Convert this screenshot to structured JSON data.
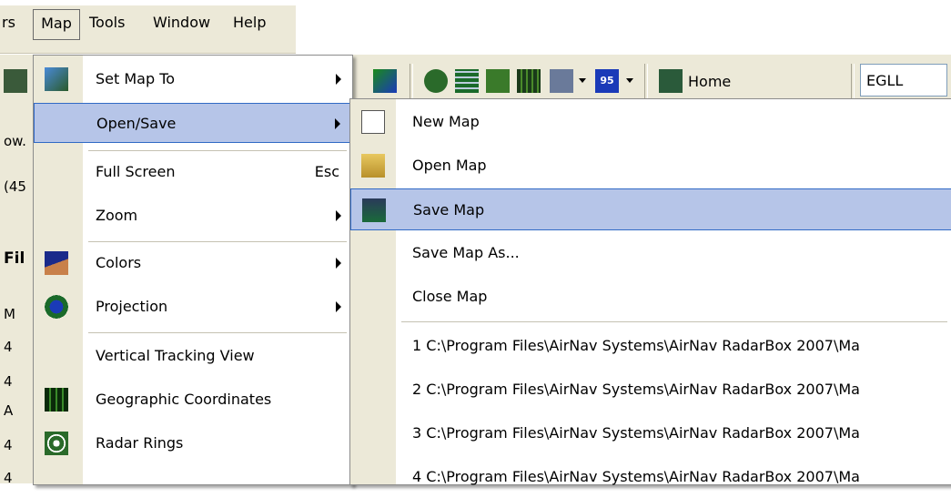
{
  "menubar": {
    "items": [
      {
        "label": "rs"
      },
      {
        "label": "Map"
      },
      {
        "label": "Tools"
      },
      {
        "label": "Window"
      },
      {
        "label": "Help"
      }
    ]
  },
  "toolbar": {
    "home_label": "Home",
    "airport_value": "EGLL",
    "route_badge": "95"
  },
  "left_strip": {
    "texts": [
      "ow.",
      "(45",
      "Fil",
      "M",
      "4",
      "4",
      "A",
      "4",
      "4"
    ]
  },
  "map_menu": {
    "items": [
      {
        "label": "Set Map To",
        "has_submenu": true,
        "icon": "map-edit-icon"
      },
      {
        "label": "Open/Save",
        "has_submenu": true,
        "highlighted": true
      },
      {
        "label": "Full Screen",
        "shortcut": "Esc"
      },
      {
        "label": "Zoom",
        "has_submenu": true
      },
      {
        "label": "Colors",
        "has_submenu": true,
        "icon": "colors-icon"
      },
      {
        "label": "Projection",
        "has_submenu": true,
        "icon": "globe-icon"
      },
      {
        "label": "Vertical Tracking View"
      },
      {
        "label": "Geographic Coordinates",
        "icon": "grid-icon"
      },
      {
        "label": "Radar Rings",
        "icon": "radar-icon"
      }
    ]
  },
  "open_save_menu": {
    "items": [
      {
        "label": "New Map",
        "icon": "new-map-icon"
      },
      {
        "label": "Open Map",
        "icon": "open-folder-icon"
      },
      {
        "label": "Save Map",
        "icon": "save-disk-icon",
        "highlighted": true
      },
      {
        "label": "Save Map As..."
      },
      {
        "label": "Close Map"
      },
      {
        "label": "1 C:\\Program Files\\AirNav Systems\\AirNav RadarBox 2007\\Ma"
      },
      {
        "label": "2 C:\\Program Files\\AirNav Systems\\AirNav RadarBox 2007\\Ma"
      },
      {
        "label": "3 C:\\Program Files\\AirNav Systems\\AirNav RadarBox 2007\\Ma"
      },
      {
        "label": "4 C:\\Program Files\\AirNav Systems\\AirNav RadarBox 2007\\Ma"
      }
    ]
  },
  "colors": {
    "highlight_bg": "#b6c5e8",
    "highlight_border": "#316ac5",
    "menu_gutter": "#ece9d8"
  }
}
